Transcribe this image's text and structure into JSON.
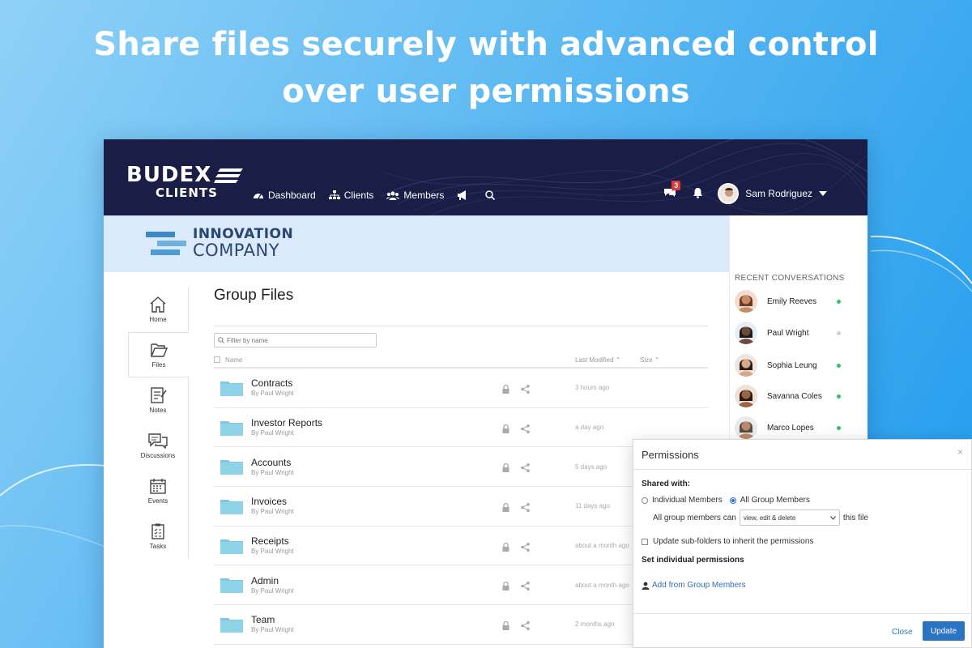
{
  "headline": {
    "line1": "Share files securely with advanced control",
    "line2": "over user permissions"
  },
  "brand": {
    "logo_top": "BUDEX",
    "logo_bottom": "CLIENTS",
    "nav_bg": "#1a1d45"
  },
  "nav": {
    "items": [
      {
        "label": "Dashboard",
        "icon": "dashboard-icon"
      },
      {
        "label": "Clients",
        "icon": "sitemap-icon"
      },
      {
        "label": "Members",
        "icon": "users-icon"
      }
    ],
    "announce_icon": "megaphone-icon",
    "search_icon": "search-icon"
  },
  "user": {
    "chat_badge": "3",
    "name": "Sam Rodriguez"
  },
  "company": {
    "line1": "INNOVATION",
    "line2": "COMPANY"
  },
  "sidenav": {
    "items": [
      {
        "label": "Home",
        "icon": "home-icon"
      },
      {
        "label": "Files",
        "icon": "folder-open-icon"
      },
      {
        "label": "Notes",
        "icon": "note-icon"
      },
      {
        "label": "Discussions",
        "icon": "discussions-icon"
      },
      {
        "label": "Events",
        "icon": "calendar-icon"
      },
      {
        "label": "Tasks",
        "icon": "clipboard-icon"
      }
    ],
    "active": "Files"
  },
  "files": {
    "title": "Group Files",
    "filter_placeholder": "Filter by name",
    "columns": {
      "name": "Name",
      "modified": "Last Modified",
      "size": "Size"
    },
    "rows": [
      {
        "name": "Contracts",
        "by": "By Paul Wright",
        "modified": "3 hours ago"
      },
      {
        "name": "Investor Reports",
        "by": "By Paul Wright",
        "modified": "a day ago"
      },
      {
        "name": "Accounts",
        "by": "By Paul Wright",
        "modified": "5 days ago"
      },
      {
        "name": "Invoices",
        "by": "By Paul Wright",
        "modified": "11 days ago"
      },
      {
        "name": "Receipts",
        "by": "By Paul Wright",
        "modified": "about a month ago"
      },
      {
        "name": "Admin",
        "by": "By Paul Wright",
        "modified": "about a month ago"
      },
      {
        "name": "Team",
        "by": "By Paul Wright",
        "modified": "2 months ago"
      }
    ]
  },
  "recent": {
    "title": "RECENT CONVERSATIONS",
    "people": [
      {
        "name": "Emily Reeves",
        "status_color": "#2ec26a"
      },
      {
        "name": "Paul Wright",
        "status_color": "#cfcfcf"
      },
      {
        "name": "Sophia Leung",
        "status_color": "#2ec26a"
      },
      {
        "name": "Savanna Coles",
        "status_color": "#2ec26a"
      },
      {
        "name": "Marco Lopes",
        "status_color": "#2ec26a"
      }
    ]
  },
  "modal": {
    "title": "Permissions",
    "shared_with_label": "Shared with:",
    "option_individual": "Individual Members",
    "option_all": "All Group Members",
    "selected_option": "All Group Members",
    "can_prefix": "All group members can",
    "permission_value": "view, edit & delete",
    "can_suffix": "this file",
    "inherit_label": "Update sub-folders to inherit the permissions",
    "set_individual_label": "Set individual permissions",
    "add_link": "Add from Group Members",
    "close_label": "Close",
    "update_label": "Update",
    "accent": "#2b73c3"
  }
}
